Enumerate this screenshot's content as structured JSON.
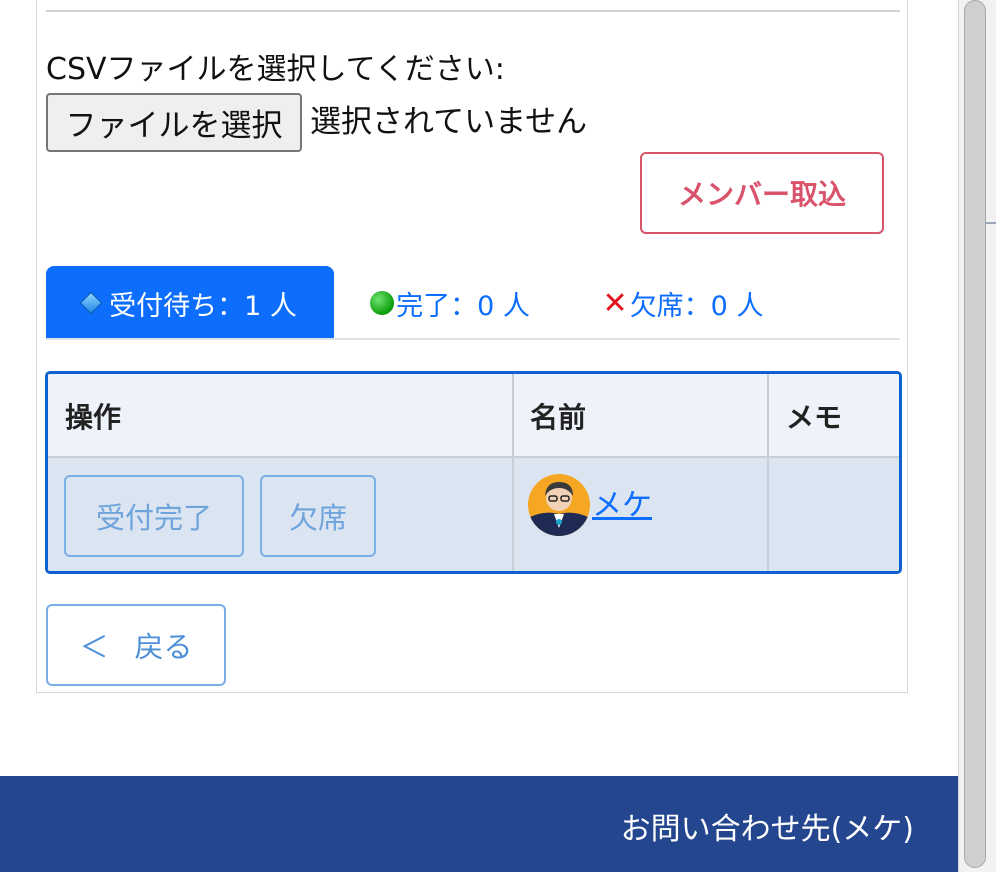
{
  "upload": {
    "label": "CSVファイルを選択してください:",
    "file_button": "ファイルを選択",
    "file_status": "選択されていません",
    "import_button": "メンバー取込"
  },
  "tabs": [
    {
      "label": "受付待ち：1 人",
      "icon": "blue-diamond-icon",
      "active": true
    },
    {
      "label": "完了：0 人",
      "icon": "green-circle-icon",
      "active": false
    },
    {
      "label": "欠席：0 人",
      "icon": "red-x-icon",
      "active": false
    }
  ],
  "table": {
    "headers": [
      "操作",
      "名前",
      "メモ"
    ],
    "rows": [
      {
        "actions": [
          "受付完了",
          "欠席"
        ],
        "name": " メケ",
        "memo": ""
      }
    ]
  },
  "back_button": {
    "arrow": "＜",
    "label": "戻る"
  },
  "footer": {
    "contact": "お問い合わせ先(メケ)"
  },
  "colors": {
    "primary": "#0d6efd",
    "danger_outline": "#d9536a",
    "footer_bg": "#23468f",
    "table_border": "#0d62d0"
  }
}
